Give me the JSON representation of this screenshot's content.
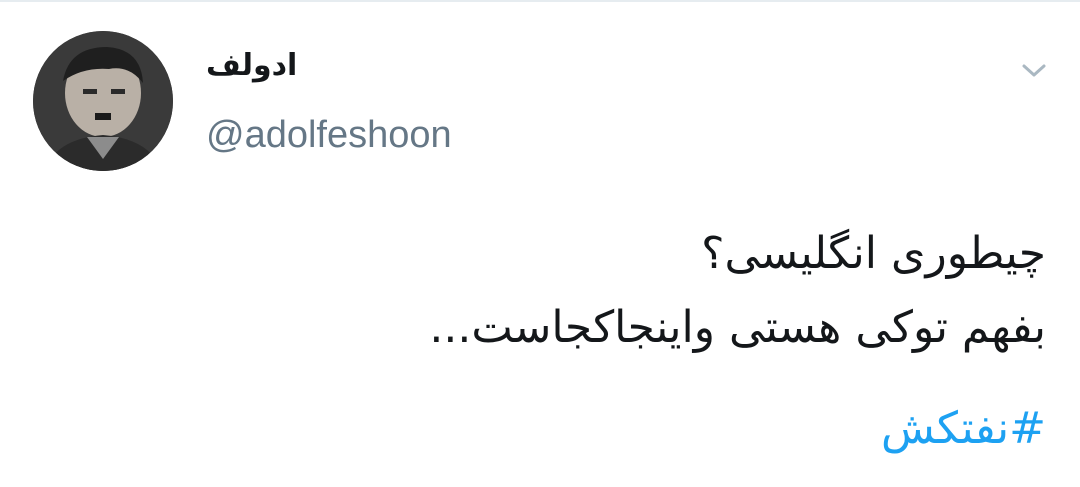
{
  "tweet": {
    "author": {
      "display_name": "ادولف",
      "handle": "@adolfeshoon",
      "avatar_icon": "profile-photo"
    },
    "menu_icon": "chevron-down-icon",
    "text_lines": [
      "چیطوری انگلیسی؟",
      "بفهم توکی هستی واینجاکجاست..."
    ],
    "hashtag": "#نفتکش"
  },
  "colors": {
    "text_primary": "#14171a",
    "text_secondary": "#657786",
    "link": "#1da1f2",
    "caret": "#aab8c2",
    "divider": "#e6ecf0"
  }
}
